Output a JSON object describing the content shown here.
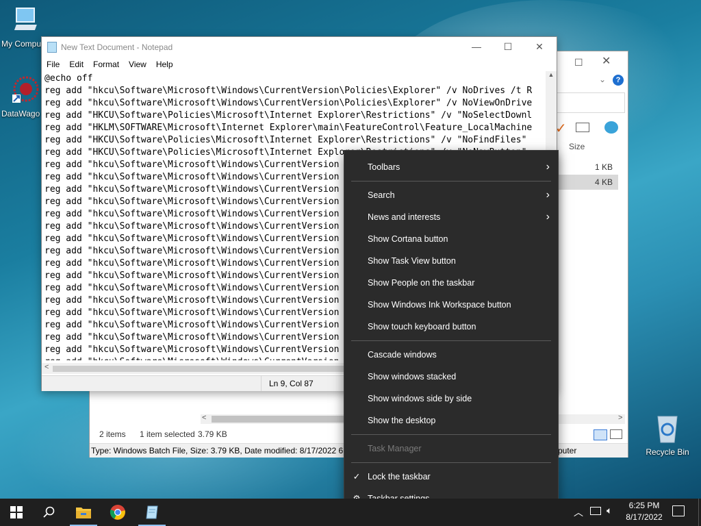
{
  "desktop": {
    "icons": [
      {
        "label": "My Compu"
      },
      {
        "label": "DataWago"
      },
      {
        "label": "Recycle Bin"
      }
    ]
  },
  "explorer": {
    "header_size": "Size",
    "rows": [
      "1 KB",
      "4 KB"
    ],
    "status_items": "2 items",
    "status_selected": "1 item selected",
    "status_size": "3.79 KB",
    "details": "Type: Windows Batch File, Size: 3.79 KB, Date modified: 8/17/2022 6:23",
    "details_right": "puter",
    "help": "?"
  },
  "notepad": {
    "title": "New Text Document - Notepad",
    "menu": [
      "File",
      "Edit",
      "Format",
      "View",
      "Help"
    ],
    "lines": [
      "@echo off",
      "reg add \"hkcu\\Software\\Microsoft\\Windows\\CurrentVersion\\Policies\\Explorer\" /v NoDrives /t R",
      "reg add \"hkcu\\Software\\Microsoft\\Windows\\CurrentVersion\\Policies\\Explorer\" /v NoViewOnDrive",
      "reg add \"HKCU\\Software\\Policies\\Microsoft\\Internet Explorer\\Restrictions\" /v \"NoSelectDownl",
      "reg add \"HKLM\\SOFTWARE\\Microsoft\\Internet Explorer\\main\\FeatureControl\\Feature_LocalMachine",
      "reg add \"HKCU\\Software\\Policies\\Microsoft\\Internet Explorer\\Restrictions\" /v \"NoFindFiles\"",
      "reg add \"HKCU\\Software\\Policies\\Microsoft\\Internet Explorer\\Restrictions\" /v \"NoNavButton\"",
      "reg add \"hkcu\\Software\\Microsoft\\Windows\\CurrentVersion",
      "reg add \"hkcu\\Software\\Microsoft\\Windows\\CurrentVersion",
      "reg add \"hkcu\\Software\\Microsoft\\Windows\\CurrentVersion",
      "reg add \"hkcu\\Software\\Microsoft\\Windows\\CurrentVersion",
      "reg add \"hkcu\\Software\\Microsoft\\Windows\\CurrentVersion",
      "reg add \"hkcu\\Software\\Microsoft\\Windows\\CurrentVersion",
      "reg add \"hkcu\\Software\\Microsoft\\Windows\\CurrentVersion",
      "reg add \"hkcu\\Software\\Microsoft\\Windows\\CurrentVersion",
      "reg add \"hkcu\\Software\\Microsoft\\Windows\\CurrentVersion",
      "reg add \"hkcu\\Software\\Microsoft\\Windows\\CurrentVersion",
      "reg add \"hkcu\\Software\\Microsoft\\Windows\\CurrentVersion",
      "reg add \"hkcu\\Software\\Microsoft\\Windows\\CurrentVersion",
      "reg add \"hkcu\\Software\\Microsoft\\Windows\\CurrentVersion",
      "reg add \"hkcu\\Software\\Microsoft\\Windows\\CurrentVersion",
      "reg add \"hkcu\\Software\\Microsoft\\Windows\\CurrentVersion",
      "reg add \"hkcu\\Software\\Microsoft\\Windows\\CurrentVersion",
      "reg add \"hkcu\\Software\\Microsoft\\Windows\\CurrentVersion",
      "reg add \"hkcu\\Software\\Microsoft\\Windows\\CurrentVersion"
    ],
    "status_position": "Ln 9, Col 87"
  },
  "context_menu": {
    "toolbars": "Toolbars",
    "search": "Search",
    "news": "News and interests",
    "cortana": "Show Cortana button",
    "task_view": "Show Task View button",
    "people": "Show People on the taskbar",
    "ink": "Show Windows Ink Workspace button",
    "touch_keyboard": "Show touch keyboard button",
    "cascade": "Cascade windows",
    "stacked": "Show windows stacked",
    "side_by_side": "Show windows side by side",
    "show_desktop": "Show the desktop",
    "task_manager": "Task Manager",
    "lock": "Lock the taskbar",
    "settings": "Taskbar settings"
  },
  "taskbar": {
    "time": "6:25 PM",
    "date": "8/17/2022"
  },
  "colors": {
    "menu_bg": "#2b2b2b",
    "taskbar_bg": "#1f1f1f",
    "accent": "#1e6fd0"
  }
}
